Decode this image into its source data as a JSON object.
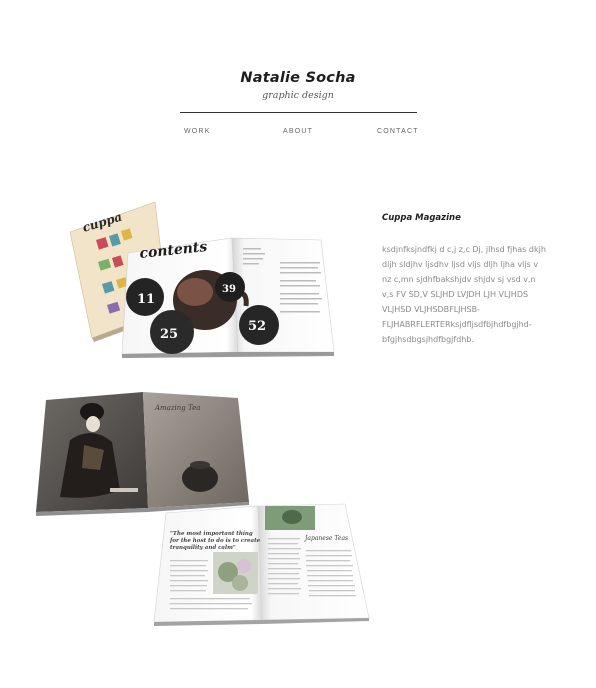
{
  "header": {
    "name": "Natalie Socha",
    "tagline": "graphic design"
  },
  "nav": {
    "work": "WORK",
    "about": "ABOUT",
    "contact": "CONTACT"
  },
  "project": {
    "title": "Cuppa Magazine",
    "description": "ksdjnfksjndfkj d c,j z,c Dj, jlhsd fjhas dkjh dljh sldjhv ljsdhv ljsd vljs dljh ljha vljs v nz c,mn sjdhfbakshjdv shjdv sj vsd v,n v,s FV SD,V SLJHD LVJDH LJH VLJHDS VLJHSD VLJHSDBFLJHSB-FLJHABRFLERTERksjdfljsdfbjhdfbgjhd-bfgjhsdbgsjhdfbgjfdhb."
  },
  "magazine_art": {
    "cover_title": "cuppa",
    "contents_heading": "contents",
    "page_numbers": [
      "11",
      "25",
      "39",
      "52"
    ],
    "spread_heading": "Amazing Tea",
    "pull_quote": "\"The most important thing for the host to do is to create tranquility and calm\"",
    "article_heading": "Japanese Teas"
  },
  "colors": {
    "background": "#ffffff",
    "rule": "#333333",
    "description_text": "#8a8a8a"
  }
}
